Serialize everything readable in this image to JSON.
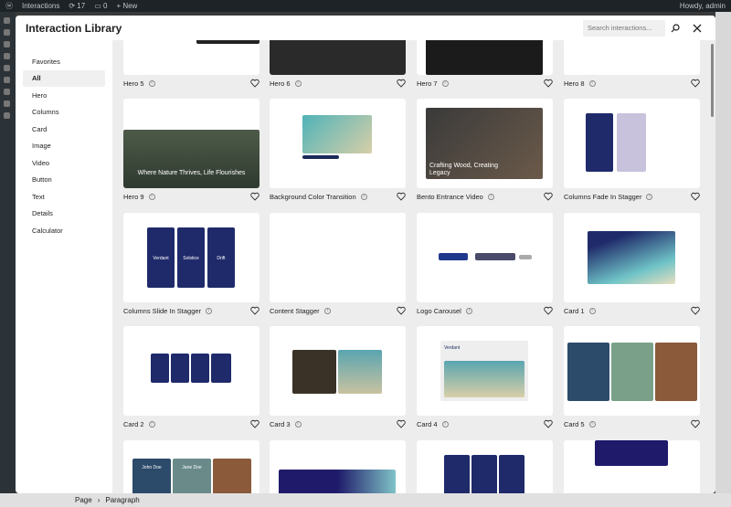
{
  "adminbar": {
    "site": "Interactions",
    "updates": "17",
    "comments": "0",
    "new": "+ New",
    "user": "Howdy, admin"
  },
  "modal": {
    "title": "Interaction Library",
    "search_placeholder": "Search interactions..."
  },
  "categories": [
    "Favorites",
    "All",
    "Hero",
    "Columns",
    "Card",
    "Image",
    "Video",
    "Button",
    "Text",
    "Details",
    "Calculator"
  ],
  "active_category": "All",
  "cards": [
    "Hero 5",
    "Hero 6",
    "Hero 7",
    "Hero 8",
    "Hero 9",
    "Background Color Transition",
    "Bento Entrance Video",
    "Columns Fade In Stagger",
    "Columns Slide In Stagger",
    "Content Stagger",
    "Logo Carousel",
    "Card 1",
    "Card 2",
    "Card 3",
    "Card 4",
    "Card 5"
  ],
  "thumb_text": {
    "hero9": "Where Nature Thrives, Life Flourishes",
    "bento": "Crafting Wood, Creating Legacy",
    "verdant": "Verdant",
    "solstice": "Solstice",
    "drift": "Drift",
    "john": "John Doe",
    "jane": "Jane Doe"
  },
  "bottombar": {
    "page": "Page",
    "paragraph": "Paragraph"
  }
}
